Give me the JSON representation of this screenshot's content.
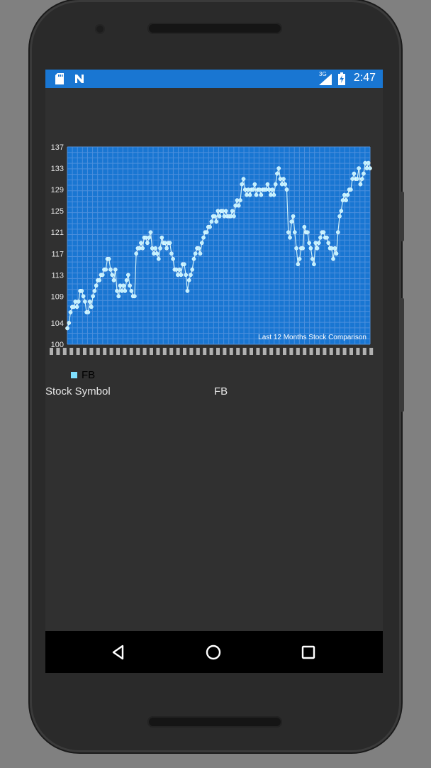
{
  "status_bar": {
    "time": "2:47",
    "network_label": "3G",
    "icons": [
      "sd-card-icon",
      "n-notification-icon",
      "signal-icon",
      "battery-icon"
    ]
  },
  "legend": {
    "label": "FB",
    "color": "#7fe0ff"
  },
  "table": {
    "header_label": "Stock Symbol",
    "value": "FB"
  },
  "chart_data": {
    "type": "line",
    "title": "Last 12 Months Stock Comparison",
    "xlabel": "",
    "ylabel": "",
    "y_ticks": [
      100,
      104,
      109,
      113,
      117,
      121,
      125,
      129,
      133,
      137
    ],
    "ylim": [
      100,
      137
    ],
    "grid": true,
    "background": "#1976d2",
    "line_color": "#cfeff7",
    "marker_color": "#bff1ff",
    "series": [
      {
        "name": "FB",
        "values": [
          103,
          104,
          106,
          107,
          107,
          108,
          107,
          108,
          110,
          110,
          109,
          108,
          106,
          106,
          108,
          107,
          109,
          110,
          111,
          112,
          112,
          113,
          113,
          114,
          114,
          116,
          116,
          114,
          113,
          112,
          114,
          110,
          109,
          111,
          110,
          111,
          110,
          112,
          113,
          111,
          110,
          109,
          109,
          117,
          118,
          118,
          119,
          118,
          120,
          120,
          119,
          120,
          121,
          118,
          117,
          118,
          117,
          116,
          118,
          120,
          119,
          119,
          118,
          119,
          119,
          117,
          116,
          114,
          114,
          113,
          114,
          113,
          115,
          115,
          113,
          110,
          112,
          113,
          114,
          116,
          117,
          118,
          118,
          117,
          119,
          120,
          121,
          121,
          122,
          122,
          123,
          124,
          124,
          123,
          125,
          124,
          125,
          125,
          124,
          125,
          124,
          124,
          124,
          125,
          124,
          126,
          127,
          126,
          127,
          130,
          131,
          129,
          128,
          129,
          128,
          129,
          129,
          130,
          128,
          129,
          129,
          128,
          129,
          129,
          129,
          130,
          129,
          128,
          129,
          128,
          130,
          132,
          133,
          131,
          130,
          131,
          130,
          129,
          121,
          120,
          123,
          124,
          121,
          118,
          115,
          116,
          118,
          118,
          122,
          121,
          121,
          119,
          118,
          116,
          115,
          119,
          118,
          119,
          120,
          121,
          121,
          120,
          120,
          119,
          118,
          118,
          116,
          118,
          117,
          121,
          124,
          125,
          127,
          128,
          127,
          128,
          129,
          129,
          131,
          132,
          131,
          131,
          133,
          130,
          131,
          132,
          134,
          133,
          134,
          133
        ]
      }
    ]
  }
}
